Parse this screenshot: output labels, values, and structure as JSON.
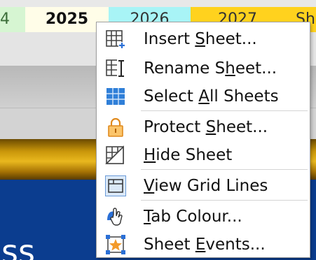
{
  "sheet_tabs": [
    {
      "label": "4"
    },
    {
      "label": "2025"
    },
    {
      "label": "2026"
    },
    {
      "label": "2027"
    },
    {
      "label": "Sh"
    }
  ],
  "background_text": "ss",
  "colors": {
    "tab_2025": "#fffde8",
    "tab_2026": "#a8f4f6",
    "tab_2027": "#ffd21e",
    "tab_partial": "#d6f5d2",
    "navy": "#0b3d8f",
    "gold": "#e9b81e"
  },
  "context_menu": {
    "items": [
      {
        "label": "Insert Sheet...",
        "mnemonic": "S",
        "icon": "insert-sheet-icon"
      },
      {
        "label": "Rename Sheet...",
        "mnemonic": "h",
        "icon": "rename-sheet-icon"
      },
      {
        "label": "Select All Sheets",
        "mnemonic": "A",
        "icon": "select-all-sheets-icon"
      },
      {
        "label": "Protect Sheet...",
        "mnemonic": "S",
        "icon": "lock-icon"
      },
      {
        "label": "Hide Sheet",
        "mnemonic": "H",
        "icon": "hide-sheet-icon"
      },
      {
        "label": "View Grid Lines",
        "mnemonic": "V",
        "icon": "grid-lines-icon",
        "checked": true
      },
      {
        "label": "Tab Colour...",
        "mnemonic": "T",
        "icon": "tab-colour-icon"
      },
      {
        "label": "Sheet Events...",
        "mnemonic": "E",
        "icon": "sheet-events-icon"
      }
    ]
  }
}
